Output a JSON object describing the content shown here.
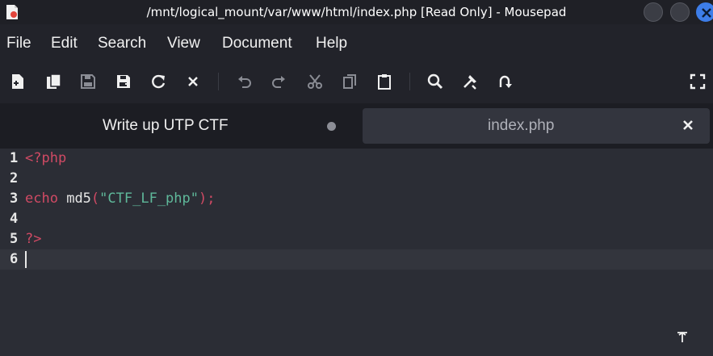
{
  "window": {
    "title": "/mnt/logical_mount/var/www/html/index.php [Read Only] - Mousepad",
    "accent": "#3d7de8"
  },
  "menu": [
    "File",
    "Edit",
    "Search",
    "View",
    "Document",
    "Help"
  ],
  "toolbar": {
    "icons": [
      "new-document-icon",
      "new-window-icon",
      "save-icon",
      "save-as-icon",
      "reload-icon",
      "close-icon",
      "undo-icon",
      "redo-icon",
      "cut-icon",
      "copy-icon",
      "paste-icon",
      "find-icon",
      "find-replace-icon",
      "go-to-icon",
      "fullscreen-icon"
    ]
  },
  "tabs": [
    {
      "label": "Write up UTP CTF",
      "modified": true,
      "active": false
    },
    {
      "label": "index.php",
      "modified": false,
      "active": true
    }
  ],
  "editor": {
    "line_numbers": [
      "1",
      "2",
      "3",
      "4",
      "5",
      "6"
    ],
    "code": {
      "line1_open": "<?php",
      "line3_kw": "echo",
      "line3_fn": "md5",
      "line3_open_paren": "(",
      "line3_string": "\"CTF_LF_php\"",
      "line3_close": ");",
      "line5_close": "?>"
    },
    "colors": {
      "keyword": "#d04a64",
      "string": "#5fb89a",
      "text": "#e6e6e6"
    }
  }
}
